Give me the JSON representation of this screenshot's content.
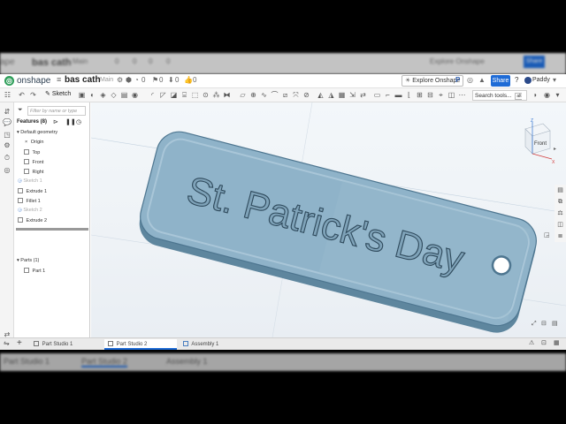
{
  "ghost_top": {
    "brand": "ape",
    "doc": "bas cath",
    "branch": "Main",
    "counts": [
      "0",
      "0",
      "0",
      "0"
    ],
    "explore": "Explore Onshape",
    "share": "Share"
  },
  "ghost_bottom": {
    "tabs": [
      "Part Studio 1",
      "Part Studio 2",
      "Assembly 1"
    ]
  },
  "titlebar": {
    "brand": "onshape",
    "doc_name": "bas cath",
    "branch": "Main",
    "counts": [
      "0",
      "0",
      "0",
      "0"
    ],
    "explore": "Explore Onshape",
    "share": "Share",
    "user": "Paddy"
  },
  "toolbar": {
    "sketch_label": "Sketch",
    "search_label": "Search tools...",
    "search_shortcut": "alt C"
  },
  "feature_panel": {
    "filter_placeholder": "Filter by name or type",
    "title": "Features (8)",
    "items": [
      "Default geometry",
      "Origin",
      "Top",
      "Front",
      "Right",
      "Sketch 1",
      "Extrude 1",
      "Fillet 1",
      "Sketch 2",
      "Extrude 2"
    ],
    "parts_header": "Parts (1)",
    "parts": [
      "Part 1"
    ]
  },
  "viewport": {
    "engraved_text": "St. Patrick's Day",
    "cube_top": "Z",
    "cube_front": "Front",
    "cube_right": "X",
    "body_color": "#8fb3c9",
    "edge_color": "#5e869e"
  },
  "tabs": [
    {
      "label": "Part Studio 1",
      "active": false
    },
    {
      "label": "Part Studio 2",
      "active": true
    },
    {
      "label": "Assembly 1",
      "active": false
    }
  ]
}
